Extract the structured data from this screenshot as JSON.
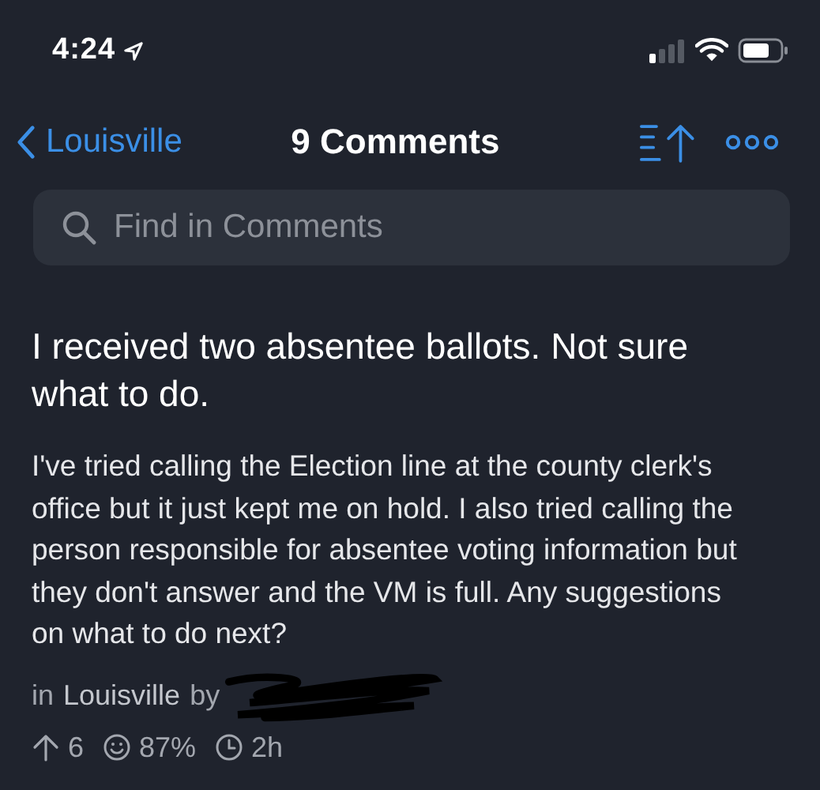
{
  "status_bar": {
    "time": "4:24"
  },
  "nav": {
    "back_label": "Louisville",
    "title": "9 Comments"
  },
  "search": {
    "placeholder": "Find in Comments"
  },
  "post": {
    "title": "I received two absentee ballots. Not sure what to do.",
    "body": "I've tried calling the Election line at the county clerk's office but it just kept me on hold. I also tried calling the person responsible for absentee voting information but they don't answer and the VM is full. Any suggestions on what to do next?",
    "community_prefix": "in",
    "community": "Louisville",
    "author_prefix": "by",
    "stats": [
      {
        "kind": "votes",
        "value": "6"
      },
      {
        "kind": "approval",
        "value": "87%"
      },
      {
        "kind": "age",
        "value": "2h"
      }
    ]
  }
}
